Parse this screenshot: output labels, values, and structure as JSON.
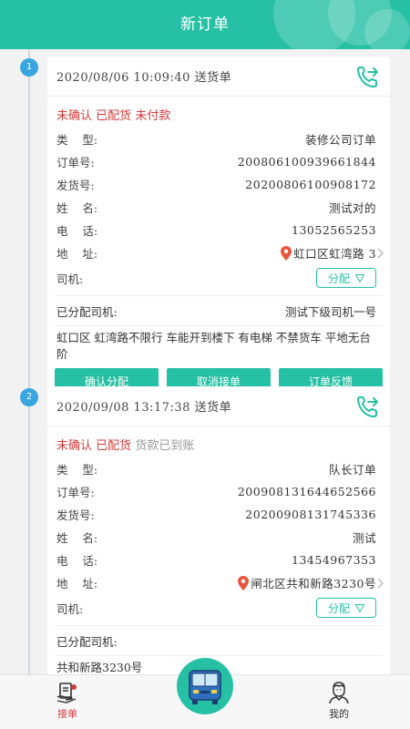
{
  "header": {
    "title": "新订单"
  },
  "orders": [
    {
      "index": "1",
      "datetime": "2020/08/06 10:09:40",
      "order_kind": "送货单",
      "status": {
        "confirm": "未确认",
        "stock": "已配货",
        "payment": "未付款"
      },
      "fields": {
        "type_label": "类    型:",
        "type_value": "装修公司订单",
        "order_no_label": "订单号:",
        "order_no_value": "200806100939661844",
        "ship_no_label": "发货号:",
        "ship_no_value": "20200806100908172",
        "name_label": "姓    名:",
        "name_value": "测试对的",
        "phone_label": "电    话:",
        "phone_value": "13052565253",
        "address_label": "地    址:",
        "address_value": "虹口区虹湾路 3",
        "driver_label": "司机:"
      },
      "assign_button": "分配",
      "assigned_driver_label": "已分配司机:",
      "assigned_driver_value": "测试下级司机一号",
      "note": "虹口区 虹湾路不限行 车能开到楼下 有电梯 不禁货车 平地无台阶",
      "actions": [
        "确认分配",
        "取消接单",
        "订单反馈"
      ]
    },
    {
      "index": "2",
      "datetime": "2020/09/08 13:17:38",
      "order_kind": "送货单",
      "status": {
        "confirm": "未确认",
        "stock": "已配货",
        "payment": "货款已到账"
      },
      "fields": {
        "type_label": "类    型:",
        "type_value": "队长订单",
        "order_no_label": "订单号:",
        "order_no_value": "200908131644652566",
        "ship_no_label": "发货号:",
        "ship_no_value": "20200908131745336",
        "name_label": "姓    名:",
        "name_value": "测试",
        "phone_label": "电    话:",
        "phone_value": "13454967353",
        "address_label": "地    址:",
        "address_value": "闸北区共和新路3230号",
        "driver_label": "司机:"
      },
      "assign_button": "分配",
      "assigned_driver_label": "已分配司机:",
      "assigned_driver_value": "",
      "note": "共和新路3230号"
    }
  ],
  "tabbar": {
    "orders_tab": "接单",
    "mine_tab": "我的"
  },
  "colors": {
    "primary": "#26c0a4",
    "alert": "#d23b3b",
    "timeline_dot": "#3aa6e0"
  },
  "icons": {
    "phone": "phone-forward-icon",
    "pin": "location-pin-icon",
    "bus": "bus-icon"
  }
}
